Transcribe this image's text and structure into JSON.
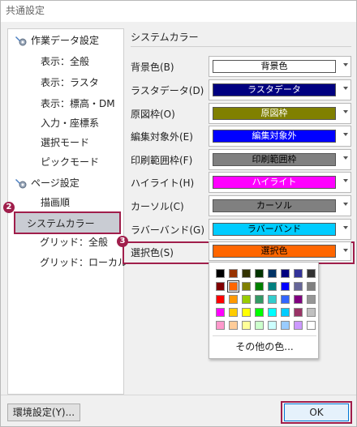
{
  "window": {
    "title": "共通設定"
  },
  "tree": {
    "groups": [
      {
        "label": "作業データ設定",
        "icon": "wrench-gear-icon",
        "items": [
          "表示：全般",
          "表示：ラスタ",
          "表示：標高・DM",
          "入力・座標系",
          "選択モード",
          "ピックモード"
        ]
      },
      {
        "label": "ページ設定",
        "icon": "wrench-gear-icon",
        "items": [
          "描画順",
          "システムカラー",
          "グリッド：全般",
          "グリッド：ローカル"
        ]
      }
    ],
    "selected": "システムカラー"
  },
  "badges": {
    "step2": "2",
    "step3": "3"
  },
  "section": {
    "title": "システムカラー"
  },
  "colors": [
    {
      "label": "背景色(B)",
      "name": "背景色",
      "bg": "#ffffff",
      "fg": "#000000"
    },
    {
      "label": "ラスタデータ(D)",
      "name": "ラスタデータ",
      "bg": "#000080",
      "fg": "#ffffff"
    },
    {
      "label": "原図枠(O)",
      "name": "原図枠",
      "bg": "#808000",
      "fg": "#ffffff"
    },
    {
      "label": "編集対象外(E)",
      "name": "編集対象外",
      "bg": "#0000ff",
      "fg": "#ffffff"
    },
    {
      "label": "印刷範囲枠(F)",
      "name": "印刷範囲枠",
      "bg": "#808080",
      "fg": "#000000"
    },
    {
      "label": "ハイライト(H)",
      "name": "ハイライト",
      "bg": "#ff00ff",
      "fg": "#ffffff"
    },
    {
      "label": "カーソル(C)",
      "name": "カーソル",
      "bg": "#808080",
      "fg": "#000000"
    },
    {
      "label": "ラバーバンド(G)",
      "name": "ラバーバンド",
      "bg": "#00ccff",
      "fg": "#000000"
    },
    {
      "label": "選択色(S)",
      "name": "選択色",
      "bg": "#ff6600",
      "fg": "#000000"
    }
  ],
  "palette": {
    "rows": [
      [
        "#000000",
        "#993300",
        "#333300",
        "#003300",
        "#003366",
        "#000080",
        "#333399",
        "#333333"
      ],
      [
        "#800000",
        "#ff6600",
        "#808000",
        "#008000",
        "#008080",
        "#0000ff",
        "#666699",
        "#808080"
      ],
      [
        "#ff0000",
        "#ff9900",
        "#99cc00",
        "#339966",
        "#33cccc",
        "#3366ff",
        "#800080",
        "#969696"
      ],
      [
        "#ff00ff",
        "#ffcc00",
        "#ffff00",
        "#00ff00",
        "#00ffff",
        "#00ccff",
        "#993366",
        "#c0c0c0"
      ],
      [
        "#ff99cc",
        "#ffcc99",
        "#ffff99",
        "#ccffcc",
        "#ccffff",
        "#99ccff",
        "#cc99ff",
        "#ffffff"
      ]
    ],
    "selected_row": 1,
    "selected_col": 1,
    "more_label": "その他の色..."
  },
  "buttons": {
    "env": "環境設定(Y)...",
    "ok": "OK"
  }
}
